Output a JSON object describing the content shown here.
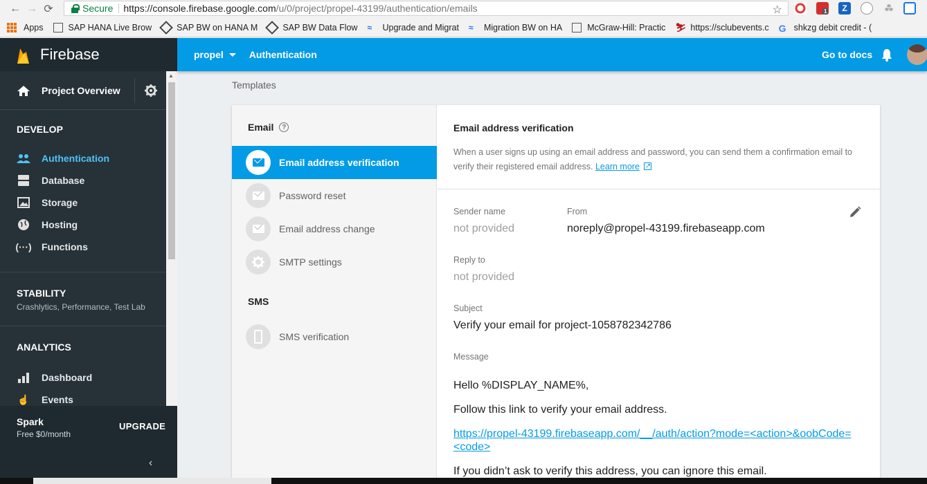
{
  "browser": {
    "secure_label": "Secure",
    "url_host": "https://console.firebase.google.com",
    "url_path": "/u/0/project/propel-43199/authentication/emails",
    "ext_badge": "1",
    "ext_z": "Z",
    "bookmarks": [
      {
        "label": "Apps",
        "icon": "apps-grid-icon"
      },
      {
        "label": "SAP HANA Live Brow",
        "icon": "document-icon"
      },
      {
        "label": "SAP BW on HANA M",
        "icon": "diamond-icon"
      },
      {
        "label": "SAP BW Data Flow",
        "icon": "diamond-icon"
      },
      {
        "label": "Upgrade and Migrat",
        "icon": "wave-icon"
      },
      {
        "label": "Migration BW on HA",
        "icon": "wave-icon"
      },
      {
        "label": "McGraw-Hill: Practic",
        "icon": "document-icon"
      },
      {
        "label": "https://sclubevents.c",
        "icon": "skier-icon"
      },
      {
        "label": "shkzg debit credit - (",
        "icon": "google-icon"
      }
    ]
  },
  "sidebar": {
    "brand": "Firebase",
    "project_overview": "Project Overview",
    "develop_title": "DEVELOP",
    "develop_items": [
      {
        "label": "Authentication",
        "icon": "people-icon",
        "active": true
      },
      {
        "label": "Database",
        "icon": "database-icon",
        "active": false
      },
      {
        "label": "Storage",
        "icon": "image-icon",
        "active": false
      },
      {
        "label": "Hosting",
        "icon": "globe-icon",
        "active": false
      },
      {
        "label": "Functions",
        "icon": "functions-icon",
        "active": false
      }
    ],
    "stability_title": "STABILITY",
    "stability_sub": "Crashlytics, Performance, Test Lab",
    "analytics_title": "ANALYTICS",
    "analytics_items": [
      {
        "label": "Dashboard",
        "icon": "bar-chart-icon"
      },
      {
        "label": "Events",
        "icon": "touch-icon"
      }
    ],
    "plan_name": "Spark",
    "plan_price": "Free $0/month",
    "upgrade_label": "UPGRADE"
  },
  "topbar": {
    "project": "propel",
    "section": "Authentication",
    "docs": "Go to docs"
  },
  "page": {
    "breadcrumb": "Templates",
    "email_section": "Email",
    "sms_section": "SMS",
    "templates": [
      {
        "label": "Email address verification",
        "icon": "envelope-icon",
        "active": true
      },
      {
        "label": "Password reset",
        "icon": "envelope-icon",
        "active": false
      },
      {
        "label": "Email address change",
        "icon": "envelope-icon",
        "active": false
      },
      {
        "label": "SMTP settings",
        "icon": "gear-icon",
        "active": false
      }
    ],
    "sms_templates": [
      {
        "label": "SMS verification",
        "icon": "phone-icon",
        "active": false
      }
    ]
  },
  "detail": {
    "title": "Email address verification",
    "desc_text": "When a user signs up using an email address and password, you can send them a confirmation email to verify their registered email address.",
    "learn_more": "Learn more",
    "sender_label": "Sender name",
    "sender_value": "not provided",
    "from_label": "From",
    "from_value": "noreply@propel-43199.firebaseapp.com",
    "reply_label": "Reply to",
    "reply_value": "not provided",
    "subject_label": "Subject",
    "subject_value": "Verify your email for project-1058782342786",
    "message_label": "Message",
    "message_greeting": "Hello %DISPLAY_NAME%,",
    "message_line1": "Follow this link to verify your email address.",
    "message_link": "https://propel-43199.firebaseapp.com/__/auth/action?mode=<action>&oobCode=<code>",
    "message_line2": "If you didn’t ask to verify this address, you can ignore this email."
  },
  "colors": {
    "accent": "#039be5",
    "sidebar_bg": "#263238",
    "active_nav": "#4fc3f7"
  }
}
